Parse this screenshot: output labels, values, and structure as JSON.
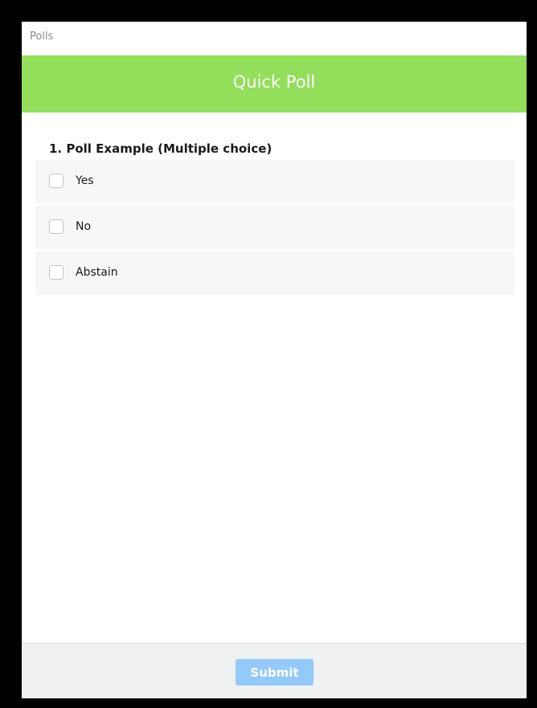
{
  "window": {
    "title": "Polls"
  },
  "header": {
    "title": "Quick Poll",
    "color": "#93de5a"
  },
  "question": {
    "title": "1. Poll Example (Multiple choice)",
    "options": [
      {
        "label": "Yes",
        "checked": false
      },
      {
        "label": "No",
        "checked": false
      },
      {
        "label": "Abstain",
        "checked": false
      }
    ]
  },
  "footer": {
    "submit_label": "Submit",
    "submit_color": "#94c9fb"
  }
}
